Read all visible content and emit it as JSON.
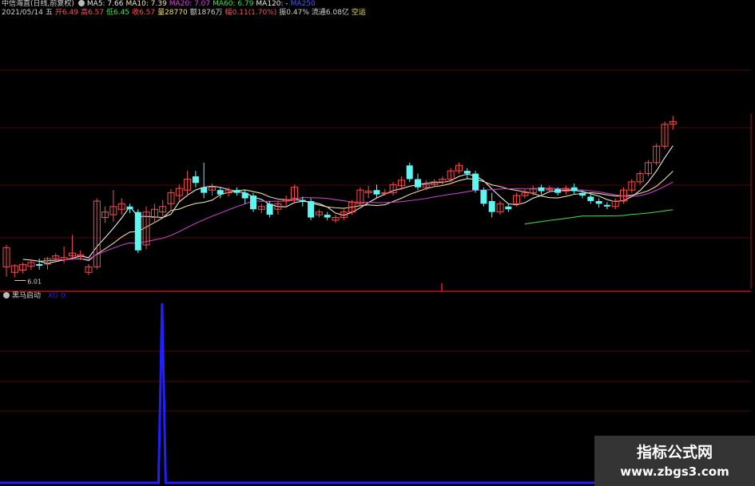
{
  "header": {
    "stock_name": "中信海直(日线,前复权)",
    "ma_items": [
      {
        "label": "MA5: 7.66",
        "color": "#e8e8e8"
      },
      {
        "label": "MA10: 7.39",
        "color": "#f2e6b0"
      },
      {
        "label": "MA20: 7.07",
        "color": "#e040e0"
      },
      {
        "label": "MA60: 6.79",
        "color": "#40e040"
      },
      {
        "label": "MA120: -",
        "color": "#e8e8e8"
      },
      {
        "label": "MA250",
        "color": "#5050ff"
      }
    ],
    "quote_items": [
      {
        "label": "2021/05/14",
        "color": "#d0d0d0"
      },
      {
        "label": "五",
        "color": "#d0d0d0"
      },
      {
        "label": "开6.49",
        "color": "#ff5050"
      },
      {
        "label": "高6.57",
        "color": "#ff5050"
      },
      {
        "label": "低6.45",
        "color": "#40e040"
      },
      {
        "label": "收6.57",
        "color": "#ff5050"
      },
      {
        "label": "量28770",
        "color": "#f0e060"
      },
      {
        "label": "额1876万",
        "color": "#d0d0d0"
      },
      {
        "label": "幅0.11(1.70%)",
        "color": "#ff5050"
      },
      {
        "label": "振0.47%",
        "color": "#d0d0d0"
      },
      {
        "label": "流通6.08亿",
        "color": "#d0d0d0"
      },
      {
        "label": "空运",
        "color": "#f0e060"
      }
    ]
  },
  "price_chart": {
    "low_price_label": "6.01",
    "candles": [
      [
        6.2,
        6.55,
        6.02,
        6.6
      ],
      [
        6.1,
        6.22,
        6.01,
        6.25
      ],
      [
        6.14,
        6.24,
        6.08,
        6.28
      ],
      [
        6.21,
        6.28,
        6.14,
        6.34
      ],
      [
        6.25,
        6.22,
        6.15,
        6.35
      ],
      [
        6.25,
        6.35,
        6.15,
        6.38
      ],
      [
        6.35,
        6.4,
        6.28,
        6.45
      ],
      [
        6.33,
        6.37,
        6.27,
        6.57
      ],
      [
        6.4,
        6.45,
        6.33,
        6.78
      ],
      [
        6.4,
        6.42,
        6.32,
        6.5
      ],
      [
        6.1,
        6.2,
        6.05,
        6.25
      ],
      [
        6.2,
        7.4,
        6.15,
        7.45
      ],
      [
        7.1,
        7.2,
        7.0,
        7.3
      ],
      [
        7.15,
        7.3,
        7.02,
        7.6
      ],
      [
        7.25,
        7.35,
        7.15,
        7.45
      ],
      [
        7.3,
        7.25,
        7.18,
        7.35
      ],
      [
        7.2,
        6.5,
        6.45,
        7.25
      ],
      [
        6.6,
        7.2,
        6.52,
        7.3
      ],
      [
        7.1,
        7.25,
        7.0,
        7.35
      ],
      [
        7.2,
        7.3,
        7.12,
        7.42
      ],
      [
        7.35,
        7.55,
        7.25,
        7.62
      ],
      [
        7.5,
        7.63,
        7.4,
        7.7
      ],
      [
        7.6,
        7.8,
        7.5,
        7.95
      ],
      [
        7.85,
        7.73,
        7.65,
        7.95
      ],
      [
        7.65,
        7.55,
        7.45,
        8.1
      ],
      [
        7.6,
        7.65,
        7.5,
        7.72
      ],
      [
        7.6,
        7.52,
        7.45,
        7.65
      ],
      [
        7.55,
        7.6,
        7.48,
        7.65
      ],
      [
        7.6,
        7.55,
        7.5,
        7.65
      ],
      [
        7.55,
        7.45,
        7.35,
        7.6
      ],
      [
        7.5,
        7.25,
        7.2,
        7.55
      ],
      [
        7.25,
        7.3,
        7.18,
        7.35
      ],
      [
        7.35,
        7.15,
        7.1,
        7.4
      ],
      [
        7.25,
        7.35,
        7.15,
        7.4
      ],
      [
        7.4,
        7.42,
        7.3,
        7.5
      ],
      [
        7.45,
        7.65,
        7.35,
        7.7
      ],
      [
        7.42,
        7.4,
        7.3,
        7.48
      ],
      [
        7.4,
        7.1,
        7.05,
        7.45
      ],
      [
        7.15,
        7.2,
        7.1,
        7.25
      ],
      [
        7.15,
        7.1,
        7.05,
        7.2
      ],
      [
        7.05,
        7.1,
        7.0,
        7.15
      ],
      [
        7.1,
        7.2,
        7.05,
        7.25
      ],
      [
        7.2,
        7.38,
        7.15,
        7.42
      ],
      [
        7.35,
        7.6,
        7.3,
        7.65
      ],
      [
        7.55,
        7.58,
        7.45,
        7.68
      ],
      [
        7.6,
        7.52,
        7.45,
        7.7
      ],
      [
        7.55,
        7.55,
        7.5,
        7.62
      ],
      [
        7.55,
        7.7,
        7.5,
        7.75
      ],
      [
        7.68,
        7.78,
        7.6,
        7.85
      ],
      [
        8.05,
        7.8,
        7.75,
        8.1
      ],
      [
        7.8,
        7.65,
        7.6,
        7.9
      ],
      [
        7.65,
        7.7,
        7.6,
        7.78
      ],
      [
        7.7,
        7.75,
        7.65,
        7.8
      ],
      [
        7.75,
        7.8,
        7.7,
        7.85
      ],
      [
        7.8,
        7.95,
        7.75,
        8.0
      ],
      [
        7.95,
        8.05,
        7.9,
        8.1
      ],
      [
        7.95,
        7.9,
        7.8,
        8.0
      ],
      [
        7.9,
        7.6,
        7.55,
        7.95
      ],
      [
        7.6,
        7.35,
        7.3,
        7.65
      ],
      [
        7.4,
        7.2,
        7.1,
        7.55
      ],
      [
        7.2,
        7.35,
        7.15,
        7.4
      ],
      [
        7.3,
        7.25,
        7.2,
        7.35
      ],
      [
        7.35,
        7.5,
        7.3,
        7.55
      ],
      [
        7.5,
        7.55,
        7.45,
        7.62
      ],
      [
        7.55,
        7.62,
        7.5,
        7.68
      ],
      [
        7.65,
        7.58,
        7.52,
        7.7
      ],
      [
        7.6,
        7.62,
        7.55,
        7.68
      ],
      [
        7.62,
        7.55,
        7.5,
        7.65
      ],
      [
        7.58,
        7.63,
        7.52,
        7.68
      ],
      [
        7.65,
        7.58,
        7.52,
        7.72
      ],
      [
        7.55,
        7.5,
        7.45,
        7.6
      ],
      [
        7.48,
        7.4,
        7.35,
        7.52
      ],
      [
        7.4,
        7.35,
        7.28,
        7.45
      ],
      [
        7.33,
        7.3,
        7.25,
        7.38
      ],
      [
        7.3,
        7.4,
        7.25,
        7.45
      ],
      [
        7.4,
        7.6,
        7.35,
        7.65
      ],
      [
        7.6,
        7.75,
        7.55,
        7.8
      ],
      [
        7.75,
        7.9,
        7.7,
        7.95
      ],
      [
        7.9,
        8.1,
        7.85,
        8.15
      ],
      [
        8.1,
        8.4,
        8.05,
        8.45
      ],
      [
        8.4,
        8.8,
        8.35,
        8.85
      ],
      [
        8.8,
        8.85,
        8.7,
        8.95
      ]
    ]
  },
  "indicator": {
    "name": "黑马启动",
    "param_label": "XG 0",
    "values": [
      0,
      0,
      0,
      0,
      0,
      0,
      0,
      0,
      0,
      0,
      0,
      0,
      0,
      0,
      0,
      0,
      0,
      0,
      0,
      0,
      0,
      0,
      0,
      0,
      0,
      0,
      0,
      0,
      0,
      0,
      0,
      0,
      0,
      0,
      0,
      0,
      0,
      0,
      0,
      0,
      0,
      0,
      0,
      0,
      0,
      1,
      0,
      0,
      0,
      0,
      0,
      0,
      0,
      0,
      0,
      0,
      0,
      0,
      0,
      0,
      0,
      0,
      0,
      0,
      0,
      0,
      0,
      0,
      0,
      0,
      0,
      0,
      0,
      0,
      0,
      0,
      0,
      0,
      0,
      0,
      0,
      0,
      0,
      0,
      0,
      0,
      0,
      0,
      0,
      0,
      0,
      0,
      0,
      0,
      0,
      0,
      0,
      0,
      0,
      0,
      0,
      0,
      0,
      0,
      0,
      0,
      0,
      0,
      0,
      0,
      0,
      0,
      0,
      0,
      0,
      0,
      0,
      0,
      0,
      0,
      0,
      0,
      0,
      0,
      0,
      0,
      0,
      0,
      0,
      0,
      0,
      0,
      0,
      0,
      0,
      0,
      0,
      0,
      0,
      0,
      0,
      0,
      0,
      0,
      0,
      0,
      0,
      0,
      0,
      0,
      0,
      0,
      0,
      0,
      0,
      0,
      0,
      0,
      0,
      0,
      0,
      0,
      0,
      0,
      0,
      0,
      0,
      0,
      0,
      0,
      0,
      0,
      0,
      0,
      0,
      0,
      0,
      0,
      0,
      0,
      0,
      0,
      0,
      0,
      0,
      0,
      0,
      0,
      0,
      0,
      0,
      0,
      0,
      0,
      0,
      0,
      0,
      0,
      0,
      0,
      0,
      0,
      0,
      0,
      0,
      0,
      0,
      0,
      0
    ]
  },
  "watermark": {
    "line1": "指标公式网",
    "line2": "www.zbgs3.com"
  },
  "colors": {
    "bg": "#000000",
    "grid": "#4a0a0a",
    "axis": "#a01010",
    "up": "#ff4a4a",
    "down": "#5ff5f0",
    "ma5": "#e8e8e8",
    "ma10": "#e8d8a0",
    "ma20": "#c040c0",
    "ma60": "#40d040",
    "indicator": "#2020ff"
  }
}
